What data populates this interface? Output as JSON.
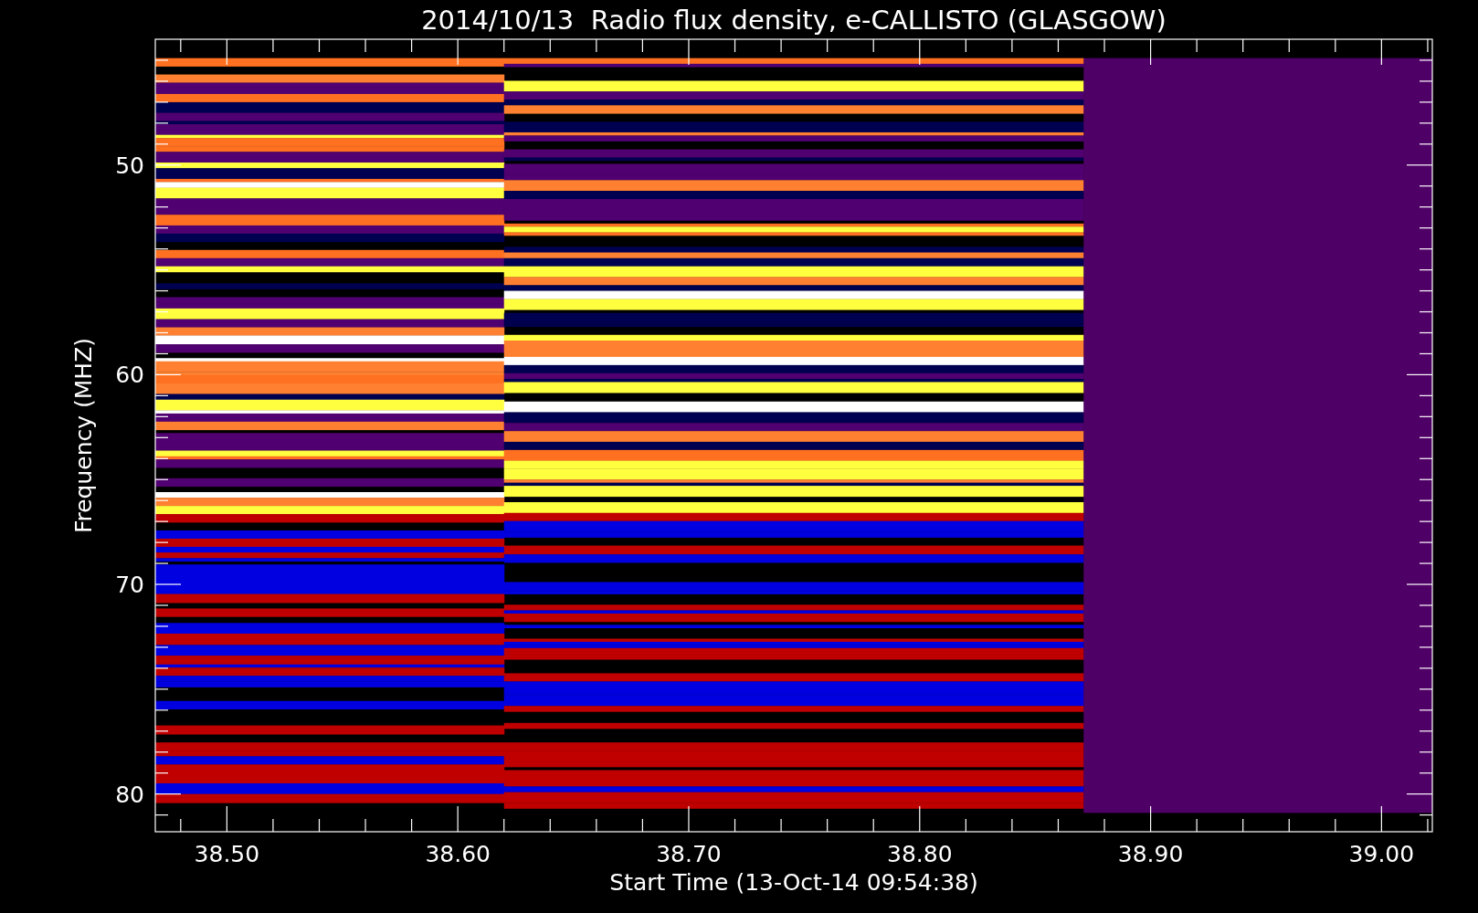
{
  "title": "2014/10/13  Radio flux density, e-CALLISTO (GLASGOW)",
  "plot": {
    "xlabel": "Start Time (13-Oct-14 09:54:38)",
    "ylabel": "Frequency (MHZ)",
    "xticks": [
      "38.50",
      "38.60",
      "38.70",
      "38.80",
      "38.90",
      "39.00"
    ],
    "yticks": [
      "50",
      "60",
      "70",
      "80"
    ]
  }
}
